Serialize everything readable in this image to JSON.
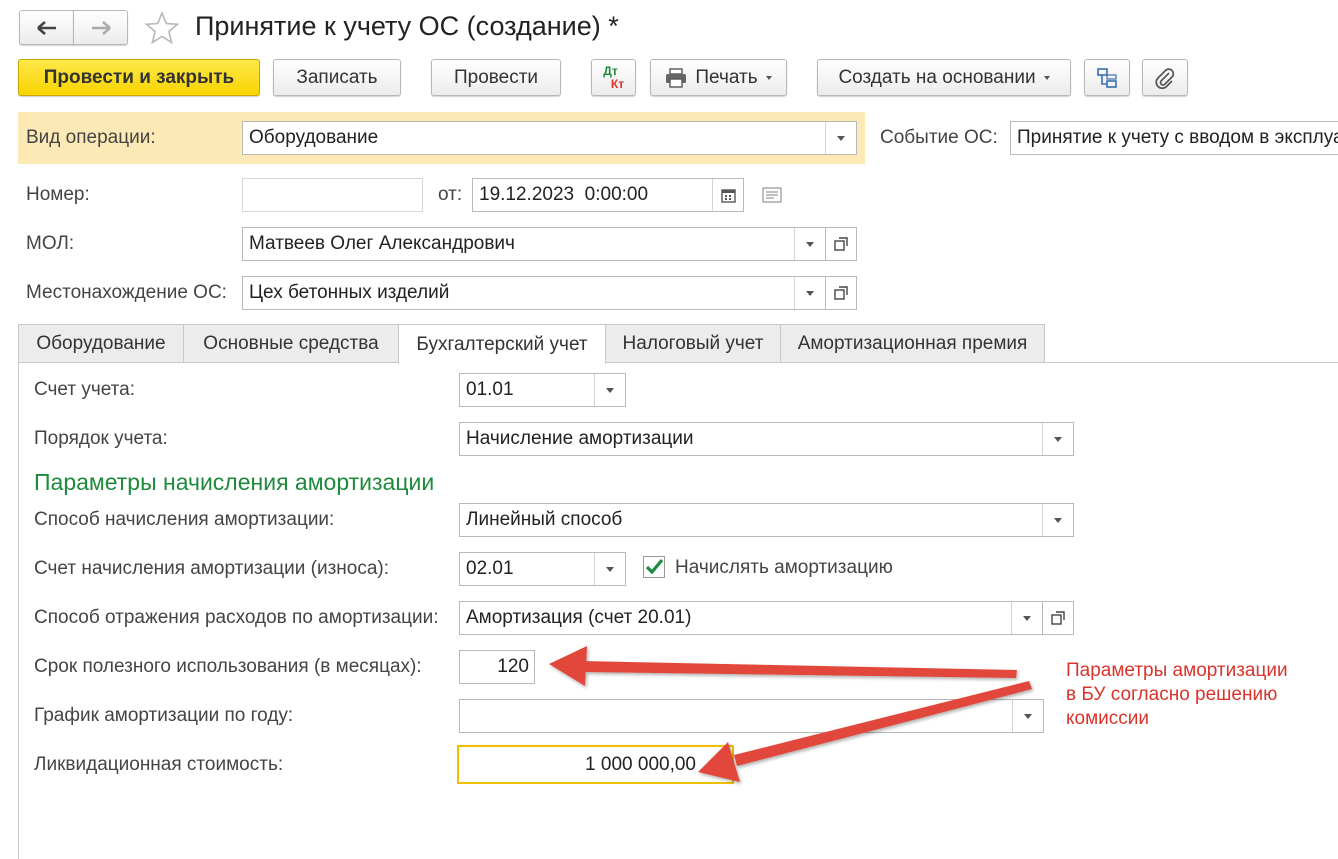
{
  "window": {
    "title": "Принятие к учету ОС (создание) *"
  },
  "toolbar": {
    "post_and_close": "Провести и закрыть",
    "save": "Записать",
    "post": "Провести",
    "dtkt_top": "Дт",
    "dtkt_bottom": "Кт",
    "print": "Печать",
    "create_based_on": "Создать на основании"
  },
  "header": {
    "operation_type_label": "Вид операции:",
    "operation_type_value": "Оборудование",
    "event_label": "Событие ОС:",
    "event_value": "Принятие к учету с вводом в эксплуатацию",
    "number_label": "Номер:",
    "number_value": "",
    "date_label": "от:",
    "date_value": "19.12.2023  0:00:00",
    "mol_label": "МОЛ:",
    "mol_value": "Матвеев Олег Александрович",
    "location_label": "Местонахождение ОС:",
    "location_value": "Цех бетонных изделий"
  },
  "tabs": [
    {
      "label": "Оборудование"
    },
    {
      "label": "Основные средства"
    },
    {
      "label": "Бухгалтерский учет"
    },
    {
      "label": "Налоговый учет"
    },
    {
      "label": "Амортизационная премия"
    }
  ],
  "active_tab": "Бухгалтерский учет",
  "accounting": {
    "account_label": "Счет учета:",
    "account_value": "01.01",
    "order_label": "Порядок учета:",
    "order_value": "Начисление амортизации",
    "section_title": "Параметры начисления амортизации",
    "method_label": "Способ начисления амортизации:",
    "method_value": "Линейный способ",
    "depr_account_label": "Счет начисления амортизации (износа):",
    "depr_account_value": "02.01",
    "accrue_label": "Начислять амортизацию",
    "accrue_checked": true,
    "expense_label": "Способ отражения расходов по амортизации:",
    "expense_value": "Амортизация (счет 20.01)",
    "life_label": "Срок полезного использования (в месяцах):",
    "life_value": "120",
    "schedule_label": "График амортизации по году:",
    "schedule_value": "",
    "salvage_label": "Ликвидационная стоимость:",
    "salvage_value": "1 000 000,00"
  },
  "annotation": {
    "lines": [
      "Параметры амортизации",
      "в БУ согласно решению",
      "комиссии"
    ],
    "color": "#d9342b"
  },
  "colors": {
    "primary_button": "#f8d400",
    "highlight_row": "#fde9b6",
    "section_title": "#1d8a3c",
    "active_field_border": "#f0c000"
  }
}
